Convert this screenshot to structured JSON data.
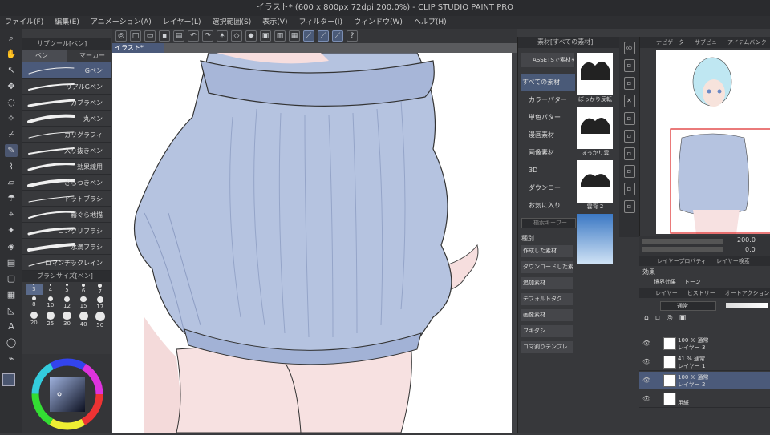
{
  "window": {
    "title": "イラスト* (600 x 800px 72dpi 200.0%) - CLIP STUDIO PAINT PRO"
  },
  "menu": [
    "ファイル(F)",
    "編集(E)",
    "アニメーション(A)",
    "レイヤー(L)",
    "選択範囲(S)",
    "表示(V)",
    "フィルター(I)",
    "ウィンドウ(W)",
    "ヘルプ(H)"
  ],
  "subtool": {
    "panel_title": "サブツール[ペン]",
    "tabs": [
      "ペン",
      "マーカー"
    ],
    "brushes": [
      "Gペン",
      "リアルGペン",
      "カブラペン",
      "丸ペン",
      "カリグラフィ",
      "入り抜きペン",
      "効果線用",
      "ざらつきペン",
      "ドットブラシ",
      "霧ぐら地描",
      "コンクリブラシ",
      "水滴ブラシ",
      "ロマンチックレイン",
      "漫画インク滲れMペン",
      "ボキンペン1"
    ],
    "selected_brush": "Gペン"
  },
  "brush_size": {
    "panel_title": "ブラシサイズ[ペン]",
    "sizes": [
      "3",
      "4",
      "5",
      "6",
      "7",
      "8",
      "10",
      "12",
      "15",
      "17",
      "20",
      "25",
      "30",
      "40",
      "50"
    ],
    "selected": "3"
  },
  "canvas": {
    "tab_label": "イラスト*"
  },
  "material": {
    "panel_title": "素材[すべての素材]",
    "assets_label": "ASSETSで素材を",
    "tree": [
      "すべての素材",
      "カラーパター",
      "単色パター",
      "漫画素材",
      "画像素材",
      "3D",
      "ダウンロー",
      "お気に入り"
    ],
    "thumbs": [
      "ぼっかり反転",
      "ぼっかり雲",
      "雲背 2",
      ""
    ],
    "search_placeholder": "検索キーワー",
    "tag_title": "種別",
    "tags": [
      "作成した素材",
      "ダウンロードした素",
      "追加素材",
      "デフォルトタグ",
      "画像素材",
      "フキダシ",
      "コマ割りテンプレ"
    ]
  },
  "navigator": {
    "tabs": [
      "ナビゲーター",
      "サブビュー",
      "アイテムバンク"
    ],
    "zoom": "200.0",
    "rotation": "0.0"
  },
  "layer_property": {
    "tabs": [
      "レイヤープロパティ",
      "レイヤー検索"
    ],
    "effect_label": "効果",
    "effects": [
      "境界効果",
      "トーン"
    ]
  },
  "layer_panel": {
    "tabs": [
      "レイヤー",
      "ヒストリー",
      "オートアクション"
    ],
    "blend_mode": "通常",
    "layers": [
      {
        "line1": "100 % 通常",
        "line2": "レイヤー 3"
      },
      {
        "line1": "41 % 通常",
        "line2": "レイヤー 1"
      },
      {
        "line1": "100 % 通常",
        "line2": "レイヤー 2"
      },
      {
        "line1": "",
        "line2": "用紙"
      }
    ],
    "selected_layer": "レイヤー 2"
  },
  "colors": {
    "accent": "#4b5a7a",
    "sweater": "#a9b7d6",
    "skin": "#f6dede"
  }
}
